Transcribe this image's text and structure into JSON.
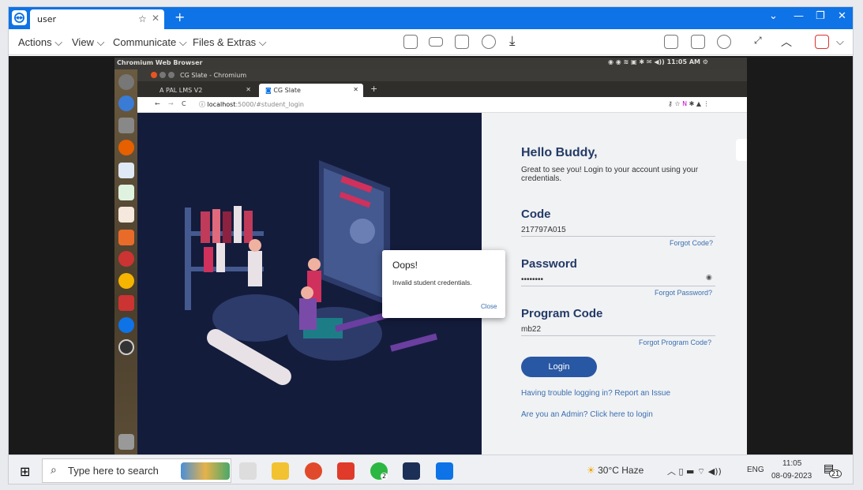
{
  "teamviewer": {
    "tab_label": "user",
    "menu": [
      "Actions",
      "View",
      "Communicate",
      "Files & Extras"
    ]
  },
  "ubuntu": {
    "panel_title": "Chromium Web Browser",
    "clock": "11:05 AM"
  },
  "chrome": {
    "window_title": "CG Slate - Chromium",
    "tabs": [
      "PAL LMS V2",
      "CG Slate"
    ],
    "url_host": "localhost",
    "url_rest": ":5000/#student_login"
  },
  "login": {
    "greeting": "Hello Buddy,",
    "subtitle": "Great to see you! Login to your account using your credentials.",
    "code_label": "Code",
    "code_value": "217797A015",
    "forgot_code": "Forgot Code?",
    "password_label": "Password",
    "password_value": "••••••••",
    "forgot_password": "Forgot Password?",
    "program_label": "Program Code",
    "program_value": "mb22",
    "forgot_program": "Forgot Program Code?",
    "login_button": "Login",
    "trouble_link": "Having trouble logging in? Report an Issue",
    "admin_link": "Are you an Admin? Click here to login"
  },
  "modal": {
    "title": "Oops!",
    "message": "Invalid student credentials.",
    "close": "Close"
  },
  "taskbar": {
    "search_placeholder": "Type here to search",
    "weather": "30°C  Haze",
    "lang": "ENG",
    "time": "11:05",
    "date": "08-09-2023",
    "notifications": "21",
    "whatsapp_badge": "2"
  }
}
